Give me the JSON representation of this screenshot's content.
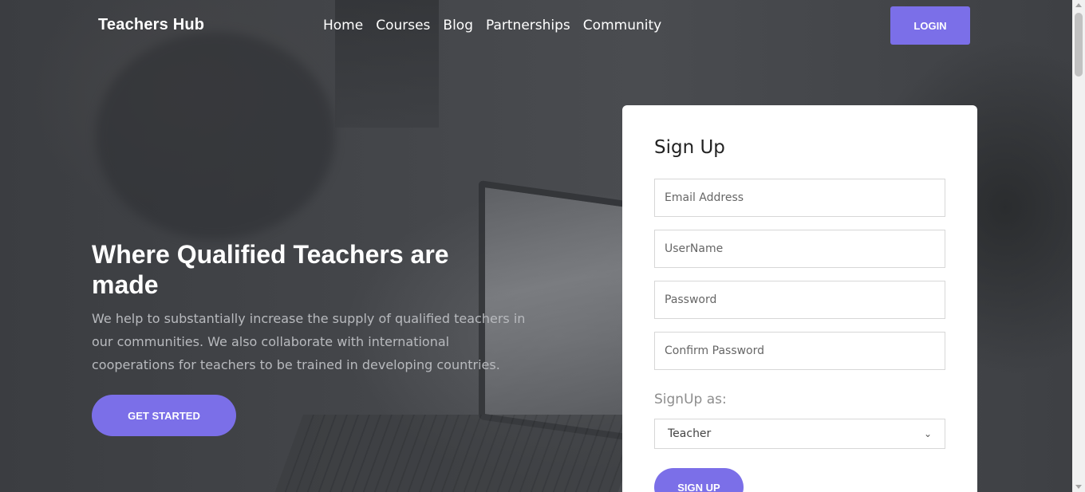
{
  "header": {
    "brand": "Teachers Hub",
    "nav": [
      "Home",
      "Courses",
      "Blog",
      "Partnerships",
      "Community"
    ],
    "login_label": "LOGIN"
  },
  "hero": {
    "headline": "Where Qualified Teachers are made",
    "description": "We help to substantially increase the supply of qualified teachers in our communities. We also collaborate with international cooperations for teachers to be trained in developing countries.",
    "cta_label": "GET STARTED"
  },
  "signup": {
    "title": "Sign Up",
    "email_placeholder": "Email Address",
    "username_placeholder": "UserName",
    "password_placeholder": "Password",
    "confirm_placeholder": "Confirm Password",
    "role_label": "SignUp as:",
    "role_selected": "Teacher",
    "submit_label": "SIGN UP"
  },
  "colors": {
    "accent": "#7b6fe8",
    "hero_overlay": "#3a3c40",
    "card_bg": "#ffffff"
  },
  "icons": {
    "select_chevron": "chevron-down-icon"
  }
}
